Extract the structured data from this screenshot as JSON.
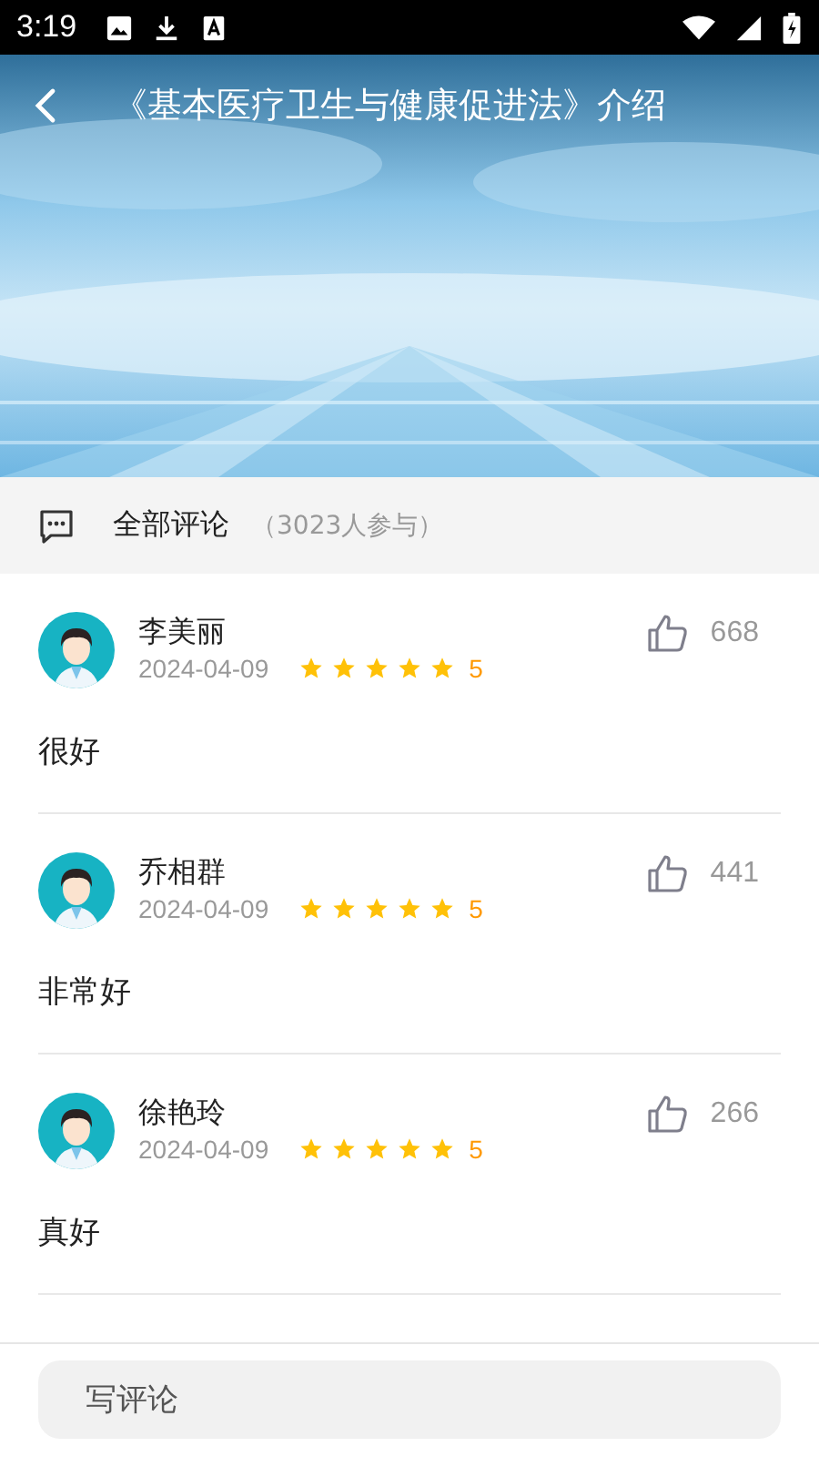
{
  "status_bar": {
    "time": "3:19"
  },
  "header": {
    "title": "《基本医疗卫生与健康促进法》介绍"
  },
  "comments_header": {
    "title": "全部评论",
    "count": "（3023人参与）"
  },
  "comments": [
    {
      "name": "李美丽",
      "date": "2024-04-09",
      "stars": 5,
      "rating": "5",
      "likes": "668",
      "text": "很好"
    },
    {
      "name": "乔相群",
      "date": "2024-04-09",
      "stars": 5,
      "rating": "5",
      "likes": "441",
      "text": "非常好"
    },
    {
      "name": "徐艳玲",
      "date": "2024-04-09",
      "stars": 5,
      "rating": "5",
      "likes": "266",
      "text": "真好"
    }
  ],
  "comment_input": {
    "placeholder": "写评论"
  }
}
